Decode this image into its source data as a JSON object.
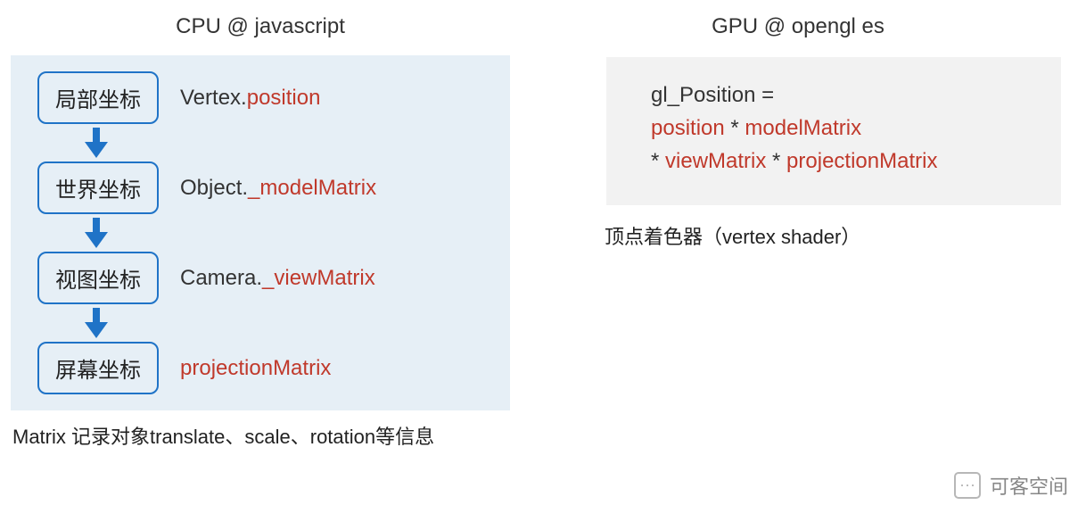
{
  "left": {
    "heading": "CPU @ javascript",
    "steps": [
      {
        "box": "局部坐标",
        "label_prefix": "Vertex.",
        "label_red": "position"
      },
      {
        "box": "世界坐标",
        "label_prefix": "Object.",
        "label_red": "_modelMatrix"
      },
      {
        "box": "视图坐标",
        "label_prefix": "Camera.",
        "label_red": "_viewMatrix"
      },
      {
        "box": "屏幕坐标",
        "label_prefix": "",
        "label_red": "projectionMatrix"
      }
    ],
    "footnote": "Matrix 记录对象translate、scale、rotation等信息"
  },
  "right": {
    "heading": "GPU @ opengl es",
    "code": {
      "line1_black": "gl_Position =",
      "line2_red1": "position",
      "line2_op1": " * ",
      "line2_red2": "modelMatrix",
      "line3_op1": "* ",
      "line3_red1": "viewMatrix",
      "line3_op2": " * ",
      "line3_red2": "projectionMatrix"
    },
    "caption": "顶点着色器（vertex shader）"
  },
  "watermark": "可客空间"
}
